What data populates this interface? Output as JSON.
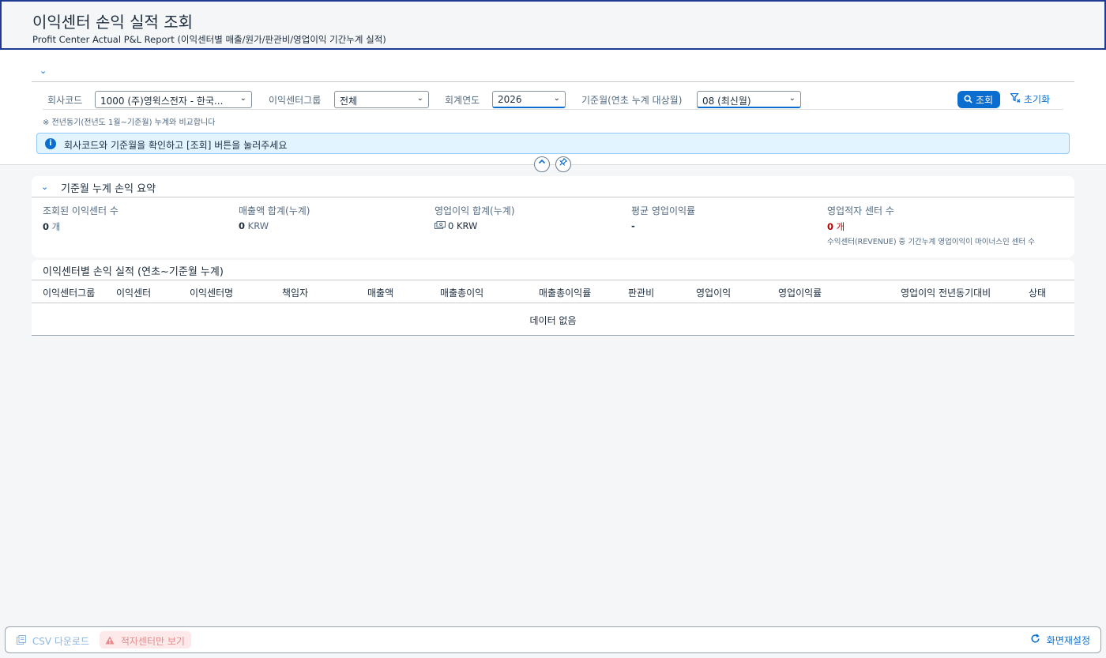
{
  "header": {
    "title": "이익센터 손익 실적 조회",
    "subtitle": "Profit Center Actual P&L Report (이익센터별 매출/원가/판관비/영업이익 기간누계 실적)"
  },
  "filters": {
    "company_code": {
      "label": "회사코드",
      "value": "1000 (주)영윅스전자 - 한국..."
    },
    "profit_center_group": {
      "label": "이익센터그룹",
      "value": "전체"
    },
    "fiscal_year": {
      "label": "회계연도",
      "value": "2026"
    },
    "base_month": {
      "label": "기준월(연초 누계 대상월)",
      "value": "08 (최신월)"
    },
    "search_label": "조회",
    "reset_label": "초기화",
    "note": "※ 전년동기(전년도 1월~기준월) 누계와 비교합니다"
  },
  "info_message": "회사코드와 기준월을 확인하고 [조회] 버튼을 눌러주세요",
  "summary": {
    "title": "기준월 누계 손익 요약",
    "kpis": [
      {
        "label": "조회된 이익센터 수",
        "value": "0",
        "unit": "개"
      },
      {
        "label": "매출액 합계(누계)",
        "value": "0",
        "unit": "KRW"
      },
      {
        "label": "영업이익 합계(누계)",
        "value": "0 KRW"
      },
      {
        "label": "평균 영업이익률",
        "value": "-"
      },
      {
        "label": "영업적자 센터 수",
        "value": "0",
        "unit": "개",
        "hint": "수익센터(REVENUE) 중 기간누계 영업이익이 마이너스인 센터 수"
      }
    ]
  },
  "table": {
    "title": "이익센터별 손익 실적 (연초~기준월 누계)",
    "columns": [
      "이익센터그룹",
      "이익센터",
      "이익센터명",
      "책임자",
      "매출액",
      "매출총이익",
      "매출총이익률",
      "판관비",
      "영업이익",
      "영업이익률",
      "영업이익 전년동기대비",
      "상태"
    ],
    "empty_text": "데이터 없음"
  },
  "footer": {
    "csv_label": "CSV 다운로드",
    "loss_only_label": "적자센터만 보기",
    "reset_screen_label": "화면재설정"
  },
  "colors": {
    "accent": "#0a6ed1",
    "negative": "#bb0000",
    "info_bg": "#e1f4ff"
  }
}
